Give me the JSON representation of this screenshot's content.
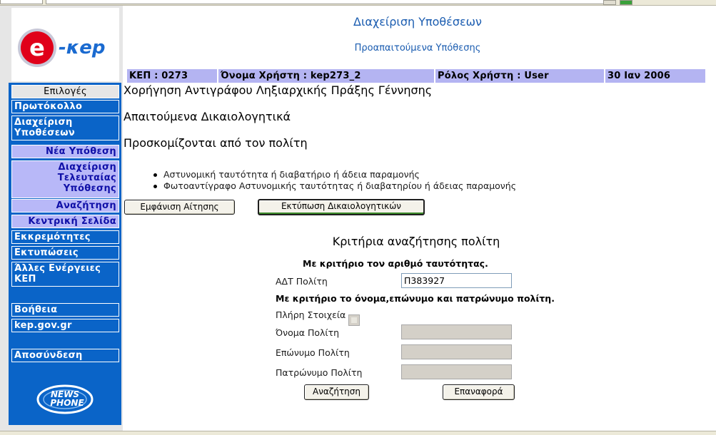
{
  "header": {
    "title": "Διαχείριση Υποθέσεων",
    "subtitle": "Προαπαιτούμενα Υπόθεσης",
    "info": {
      "kep": "ΚΕΠ : 0273",
      "username": "Όνομα Χρήστη : kep273_2",
      "role": "Ρόλος Χρήστη : User",
      "date": "30 Ιαν 2006"
    }
  },
  "logos": {
    "main_icon": "e-kep-logo",
    "main_text": "e-kep",
    "footer_icon": "newsphone-logo",
    "footer_text": "NEWS PHONE"
  },
  "sidebar": {
    "heading": "Επιλογές",
    "items": [
      {
        "label": "Πρωτόκολλο"
      },
      {
        "label": "Διαχείριση Υποθέσεων"
      },
      {
        "label": "Νέα Υπόθεση"
      },
      {
        "label": "Διαχείριση Τελευταίας Υπόθεσης"
      },
      {
        "label": "Αναζήτηση"
      },
      {
        "label": "Κεντρική Σελίδα"
      },
      {
        "label": "Εκκρεμότητες"
      },
      {
        "label": "Εκτυπώσεις"
      },
      {
        "label": "Άλλες Ενέργειες ΚΕΠ"
      },
      {
        "label": "Βοήθεια"
      },
      {
        "label": "kep.gov.gr"
      },
      {
        "label": "Αποσύνδεση"
      }
    ]
  },
  "main": {
    "case_title": "Χορήγηση Αντιγράφου Ληξιαρχικής Πράξης Γέννησης",
    "required_docs_heading": "Απαιτούμενα Δικαιολογητικά",
    "brought_by_heading": "Προσκομίζονται από τον πολίτη",
    "documents": [
      "Αστυνομική ταυτότητα ή διαβατήριο ή άδεια παραμονής",
      "Φωτοαντίγραφο Αστυνομικής ταυτότητας ή διαβατηρίου ή άδειας παραμονής"
    ],
    "buttons": {
      "show_application": "Εμφάνιση Αίτησης",
      "print_documents": "Εκτύπωση Δικαιολογητικών"
    }
  },
  "search": {
    "title": "Κριτήρια αναζήτησης πολίτη",
    "by_id_label": "Με κριτήριο τον αριθμό ταυτότητας.",
    "id_field_label": "ΑΔΤ Πολίτη",
    "id_value": "Π383927",
    "by_name_label": "Με κριτήριο το όνομα,επώνυμο και πατρώνυμο πολίτη.",
    "full_details_label": "Πλήρη Στοιχεία",
    "first_name_label": "Όνομα Πολίτη",
    "last_name_label": "Επώνυμο Πολίτη",
    "father_name_label": "Πατρώνυμο Πολίτη",
    "first_name_value": "",
    "last_name_value": "",
    "father_name_value": "",
    "search_button": "Αναζήτηση",
    "reset_button": "Επαναφορά"
  },
  "colors": {
    "sidebar_blue": "#0a64c8",
    "info_bar": "#b4b4f2",
    "title_blue": "#1a5cb0",
    "logo_red": "#e0001a"
  }
}
